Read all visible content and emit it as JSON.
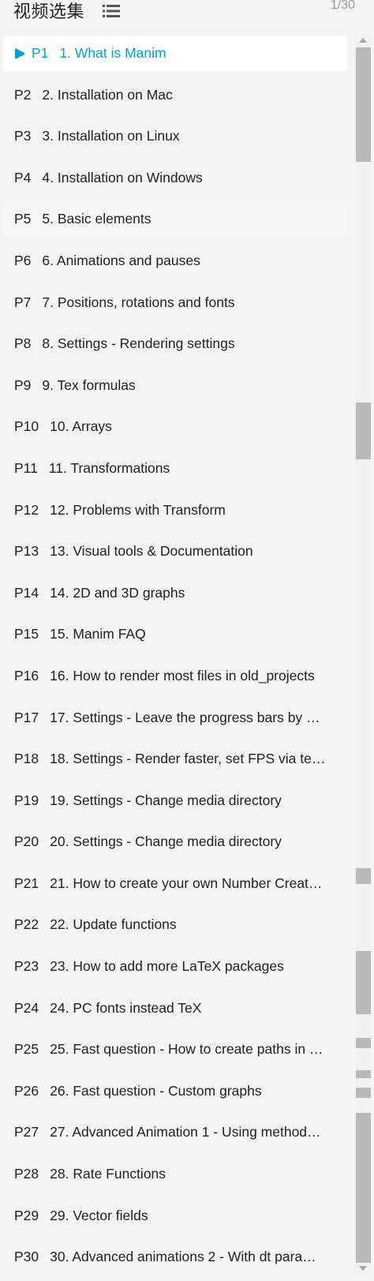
{
  "header": {
    "title": "视频选集",
    "list_icon": "list-icon",
    "page_count": "1/30"
  },
  "colors": {
    "accent": "#00a1d6",
    "text": "#212121",
    "active_bg": "#ffffff",
    "page_bg": "#f4f4f4"
  },
  "playlist": {
    "active_index": 0,
    "items": [
      {
        "p": "P1",
        "title": "1. What is Manim"
      },
      {
        "p": "P2",
        "title": "2. Installation on Mac"
      },
      {
        "p": "P3",
        "title": "3. Installation on Linux"
      },
      {
        "p": "P4",
        "title": "4. Installation on Windows"
      },
      {
        "p": "P5",
        "title": "5. Basic elements"
      },
      {
        "p": "P6",
        "title": "6. Animations and pauses"
      },
      {
        "p": "P7",
        "title": "7. Positions, rotations and fonts"
      },
      {
        "p": "P8",
        "title": "8. Settings - Rendering settings"
      },
      {
        "p": "P9",
        "title": "9. Tex formulas"
      },
      {
        "p": "P10",
        "title": "10. Arrays"
      },
      {
        "p": "P11",
        "title": "11. Transformations"
      },
      {
        "p": "P12",
        "title": "12. Problems with Transform"
      },
      {
        "p": "P13",
        "title": "13. Visual tools & Documentation"
      },
      {
        "p": "P14",
        "title": "14. 2D and 3D graphs"
      },
      {
        "p": "P15",
        "title": "15. Manim FAQ"
      },
      {
        "p": "P16",
        "title": "16. How to render most files in old_projects"
      },
      {
        "p": "P17",
        "title": "17. Settings - Leave the progress bars by …"
      },
      {
        "p": "P18",
        "title": "18. Settings - Render faster, set FPS via te…"
      },
      {
        "p": "P19",
        "title": "19. Settings - Change media directory"
      },
      {
        "p": "P20",
        "title": "20. Settings - Change media directory"
      },
      {
        "p": "P21",
        "title": "21. How to create your own Number Creat…"
      },
      {
        "p": "P22",
        "title": "22. Update functions"
      },
      {
        "p": "P23",
        "title": "23. How to add more LaTeX packages"
      },
      {
        "p": "P24",
        "title": "24. PC fonts instead TeX"
      },
      {
        "p": "P25",
        "title": "25. Fast question - How to create paths in …"
      },
      {
        "p": "P26",
        "title": "26. Fast question - Custom graphs"
      },
      {
        "p": "P27",
        "title": "27. Advanced Animation 1 - Using method…"
      },
      {
        "p": "P28",
        "title": "28. Rate Functions"
      },
      {
        "p": "P29",
        "title": "29. Vector fields"
      },
      {
        "p": "P30",
        "title": "30. Advanced animations 2 - With dt para…"
      }
    ]
  }
}
